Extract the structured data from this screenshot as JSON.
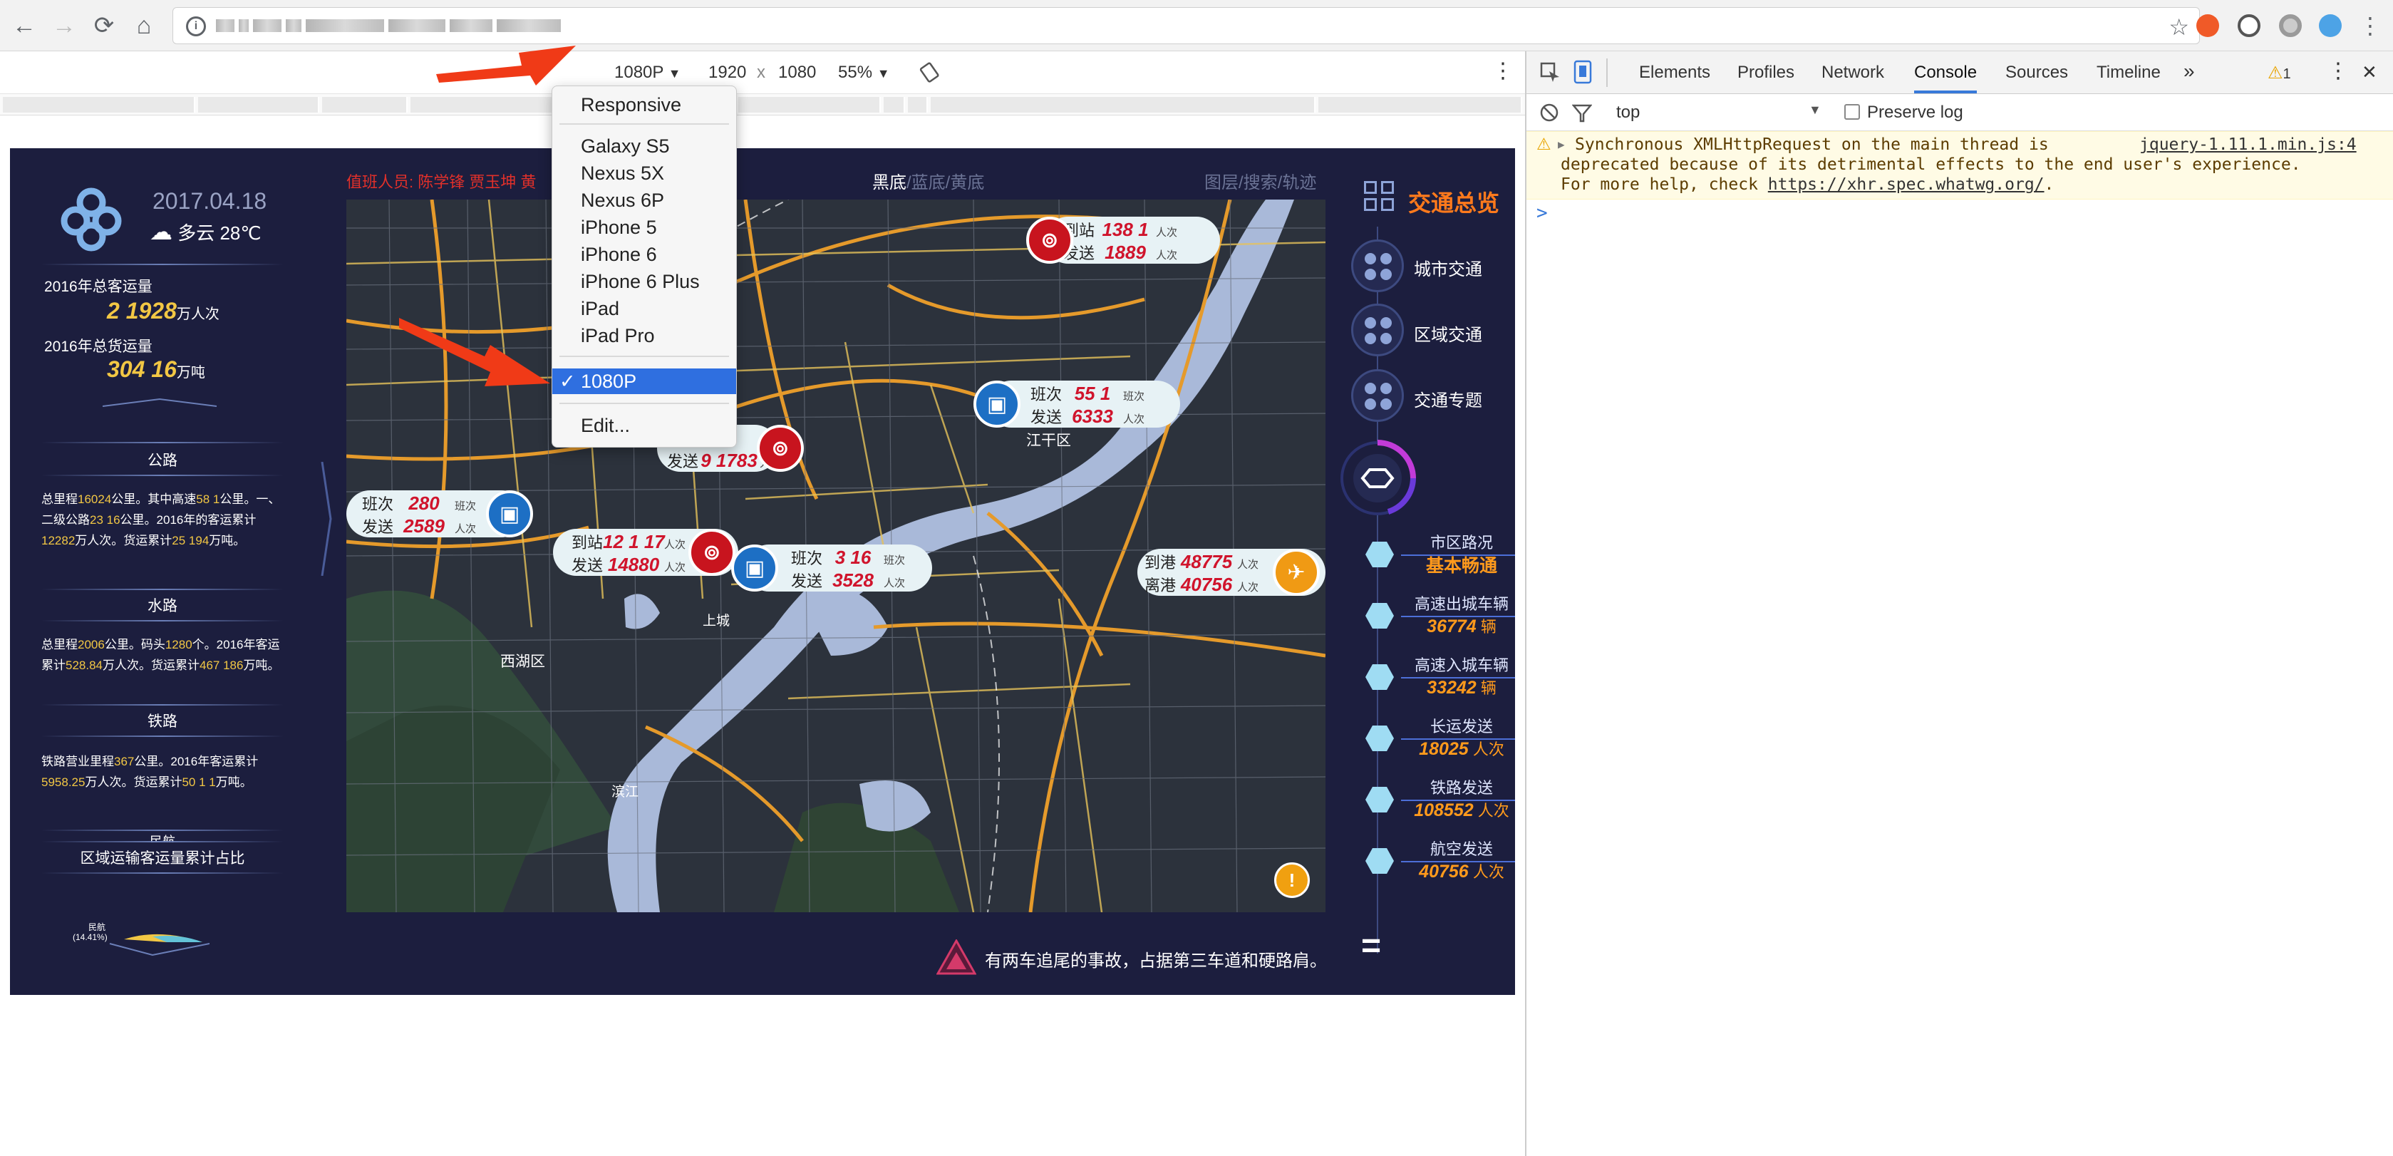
{
  "browser": {
    "tool_buttons": {
      "back": "←",
      "forward": "→",
      "reload": "⟳",
      "home": "⌂",
      "info": "i",
      "star": "☆"
    }
  },
  "device_toolbar": {
    "device": "1080P",
    "width": "1920",
    "times": "x",
    "height": "1080",
    "zoom": "55%",
    "caret": "▼",
    "more": "⋮"
  },
  "device_menu": {
    "items": [
      "Responsive",
      "Galaxy S5",
      "Nexus 5X",
      "Nexus 6P",
      "iPhone 5",
      "iPhone 6",
      "iPhone 6 Plus",
      "iPad",
      "iPad Pro",
      "1080P",
      "Edit..."
    ],
    "selected": "1080P",
    "check": "✓"
  },
  "dashboard": {
    "date": "2017.04.18",
    "weather": "多云 28℃",
    "passenger_label": "2016年总客运量",
    "passenger_value": "2 1928",
    "passenger_unit": "万人次",
    "freight_label": "2016年总货运量",
    "freight_value": "304 16",
    "freight_unit": "万吨",
    "road_title": "公路",
    "road_text_1": "总里程",
    "road_value_1": "16024",
    "road_text_2": "公里。其中高速",
    "road_value_2": "58 1",
    "road_text_3": "公里。一、二级公路",
    "road_value_3": "23 16",
    "road_text_4": "公里。2016年的客运累计",
    "road_value_4": "12282",
    "road_text_5": "万人次。货运累计",
    "road_value_5": "25 194",
    "road_text_6": "万吨。",
    "water_title": "水路",
    "water_text_1": "总里程",
    "water_value_1": "2006",
    "water_text_2": "公里。码头",
    "water_value_2": "1280",
    "water_text_3": "个。2016年客运累计",
    "water_value_3": "528.84",
    "water_text_4": "万人次。货运累计",
    "water_value_4": "467 186",
    "water_text_5": "万吨。",
    "rail_title": "铁路",
    "rail_text_1": "铁路营业里程",
    "rail_value_1": "367",
    "rail_text_2": "公里。2016年客运累计",
    "rail_value_2": "5958.25",
    "rail_text_3": "万人次。货运累计",
    "rail_value_3": "50 1 1",
    "rail_text_4": "万吨。",
    "air_title": "民航",
    "share_title": "区域运输客运量累计占比",
    "pie_label": "民航",
    "pie_value": "(14.41%)",
    "duty": "值班人员: 陈学锋 贾玉坤 黄",
    "mode_tabs": {
      "black": "黑底",
      "sep1": "/",
      "blue": "蓝底",
      "sep2": "/",
      "yellow": "黄底"
    },
    "right_tabs": "图层/搜索/轨迹",
    "map_labels": {
      "district_1": "江干区",
      "district_2": "西湖区",
      "district_3": "上城",
      "district_4": "滨江"
    },
    "callouts": [
      {
        "l1": "到站",
        "v1": "138 1",
        "u1": "人次",
        "l2": "发送",
        "v2": "1889",
        "u2": "人次"
      },
      {
        "l1": "班次",
        "v1": "55 1",
        "u1": "班次",
        "l2": "发送",
        "v2": "6333",
        "u2": "人次"
      },
      {
        "l1": "",
        "v1": "",
        "u1": "",
        "l2": "发送",
        "v2": "9 1783",
        "u2": "人次"
      },
      {
        "l1": "班次",
        "v1": "280",
        "u1": "班次",
        "l2": "发送",
        "v2": "2589",
        "u2": "人次"
      },
      {
        "l1": "到站",
        "v1": "12 1 17",
        "u1": "人次",
        "l2": "发送",
        "v2": "14880",
        "u2": "人次"
      },
      {
        "l1": "班次",
        "v1": "3 16",
        "u1": "班次",
        "l2": "发送",
        "v2": "3528",
        "u2": "人次"
      },
      {
        "l1": "到港",
        "v1": "48775",
        "u1": "人次",
        "l2": "离港",
        "v2": "40756",
        "u2": "人次"
      }
    ],
    "alert": "有两车追尾的事故，占据第三车道和硬路肩。",
    "right_title": "交通总览",
    "nav": [
      "城市交通",
      "区域交通",
      "交通专题"
    ],
    "stats": [
      {
        "label": "市区路况",
        "value": "基本畅通",
        "unit": ""
      },
      {
        "label": "高速出城车辆",
        "value": "36774",
        "unit": " 辆"
      },
      {
        "label": "高速入城车辆",
        "value": "33242",
        "unit": " 辆"
      },
      {
        "label": "长运发送",
        "value": "18025",
        "unit": " 人次"
      },
      {
        "label": "铁路发送",
        "value": "108552",
        "unit": " 人次"
      },
      {
        "label": "航空发送",
        "value": "40756",
        "unit": " 人次"
      }
    ],
    "menu_bars": "="
  },
  "devtools": {
    "tabs": [
      "Elements",
      "Profiles",
      "Network",
      "Console",
      "Sources",
      "Timeline"
    ],
    "active_tab": "Console",
    "more": "»",
    "warn_count": "1",
    "warn_icon": "⚠",
    "close": "✕",
    "context": "top",
    "preserve_log": "Preserve log",
    "message_line1": "Synchronous XMLHttpRequest on the main thread is",
    "message_source": "jquery-1.11.1.min.js:4",
    "message_line2": "deprecated because of its detrimental effects to the end user's experience.",
    "message_line3a": "For more help, check ",
    "message_link": "https://xhr.spec.whatwg.org/",
    "message_line3b": ".",
    "prompt": ">"
  },
  "colors": {
    "dash_bg": "#1c1e3e",
    "map_bg": "#2c323c",
    "accent_orange": "#ff7a1c",
    "value_yellow": "#f2c744",
    "value_red": "#d0142c",
    "select_blue": "#2f6fe0",
    "annotation_red": "#f03a17"
  }
}
